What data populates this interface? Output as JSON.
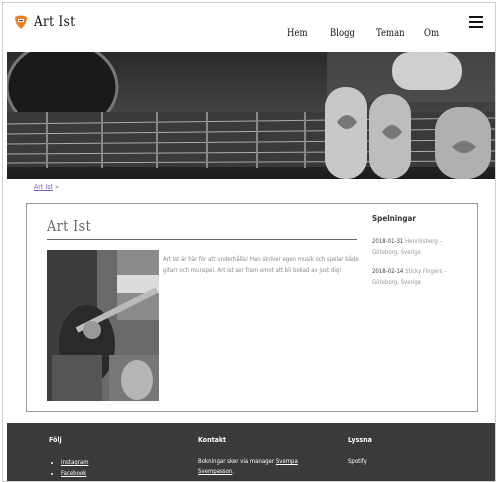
{
  "header": {
    "site_title": "Art Ist",
    "nav": [
      "Hem",
      "Blogg",
      "Teman",
      "Om"
    ]
  },
  "breadcrumb": {
    "link": "Art Ist",
    "separator": "»"
  },
  "content": {
    "title": "Art Ist",
    "bio": "Art Ist är här för att underhålla! Han skriver egen musik och spelar både gitarr och munspel. Art Ist ser fram emot att bli bokad av just dig!"
  },
  "gigs": {
    "title": "Spelningar",
    "items": [
      {
        "date": "2018-01-31",
        "venue": "Henriksberg – Göteborg, Sverige"
      },
      {
        "date": "2018-02-14",
        "venue": "Sticky Fingers – Göteborg, Sverige"
      }
    ]
  },
  "footer": {
    "col1_title": "Följ",
    "links": [
      "Instagram",
      "Facebook"
    ],
    "col2_title": "Kontakt",
    "contact_text": "Bokningar sker via manager",
    "manager_link": "Svempa Svempasson",
    "contact_end": ".",
    "col3_title": "Lyssna",
    "listen": "Spotify"
  },
  "colors": {
    "accent": "#e8802a",
    "link": "#7a5fb0",
    "footer_bg": "#3a3a3a"
  }
}
